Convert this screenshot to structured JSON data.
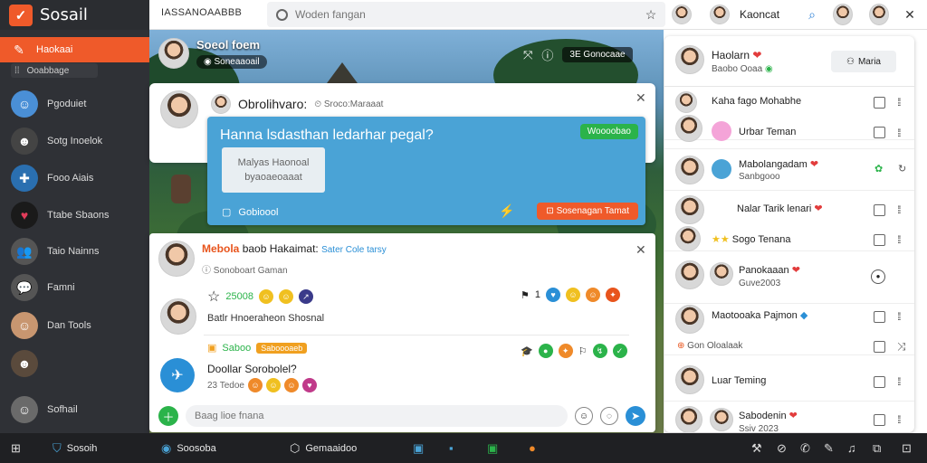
{
  "brand": {
    "name": "Sosail",
    "logo_icon": "check-icon"
  },
  "app_title": "IASSANOAABBB",
  "search": {
    "placeholder": "Woden fangan"
  },
  "top_user": {
    "name": "Kaoncat"
  },
  "sidebar": {
    "active": {
      "label": "Haokaai"
    },
    "sub_label": "Ooabbage",
    "items": [
      {
        "label": "Pgoduiet"
      },
      {
        "label": "Sotg Inoelok"
      },
      {
        "label": "Fooo Aiais"
      },
      {
        "label": "Ttabe Sbaons"
      },
      {
        "label": "Taio Nainns"
      },
      {
        "label": "Famni"
      },
      {
        "label": "Dan Tools"
      },
      {
        "label": ""
      },
      {
        "label": "Sofhail"
      }
    ]
  },
  "stream": {
    "title": "Soeol foem",
    "viewer_badge": "Soneaaoail",
    "badge_label": "3E Gonocaae"
  },
  "card1": {
    "name": "Obrolihvaro:",
    "sub": "Sroco:Maraaat",
    "panel_heading": "Hanna lsdasthan ledarhar pegal?",
    "tag": "Woooobao",
    "inner_line1": "Malyas Haonoal",
    "inner_line2": "byaoaeoaaat",
    "foot_label": "Gobioool",
    "cta": "Sosenagan Tamat"
  },
  "card2": {
    "post1_name_hi": "Mebola",
    "post1_name": "baob Hakaimat:",
    "post1_tag": "Sater Cole tarsy",
    "post1_sub": "Sonoboart Gaman",
    "post1_count": "25008",
    "post1_num": "1",
    "post1_body": "Batlr Hnoeraheon Shosnal",
    "post2_label": "Saboo",
    "post2_tag": "Saboooaeb",
    "post2_body": "Doollar Sorobolel?",
    "post2_sub": "23 Tedoe"
  },
  "reply": {
    "placeholder": "Baag lioe fnana"
  },
  "right_panel": {
    "header_name": "Haolarn",
    "header_sub": "Baobo Ooaa",
    "header_button": "Maria",
    "friends": [
      {
        "name": "Kaha fago Mohabhe",
        "sub": ""
      },
      {
        "name": "Urbar Teman",
        "sub": ""
      },
      {
        "name": "Mabolangadam",
        "sub": "Sanbgooo"
      },
      {
        "name": "Nalar Tarik lenari",
        "sub": "Sarbo aban"
      },
      {
        "name": "Sogo Tenana",
        "sub": ""
      },
      {
        "name": "Panokaaan",
        "sub": "Guve2003"
      },
      {
        "name": "Maotooaka Pajmon",
        "sub": "Gon Oloalaak"
      },
      {
        "name": "Luar Teming",
        "sub": ""
      },
      {
        "name": "Sabodenin",
        "sub": "Ssiv 2023"
      }
    ]
  },
  "taskbar": {
    "start": "Sosoih",
    "app1": "Soosoba",
    "app2": "Gemaaidoo"
  },
  "colors": {
    "accent": "#ef5a2a",
    "panel_blue": "#4aa3d6",
    "green": "#2bb34a",
    "sidebar": "#2f3136"
  }
}
